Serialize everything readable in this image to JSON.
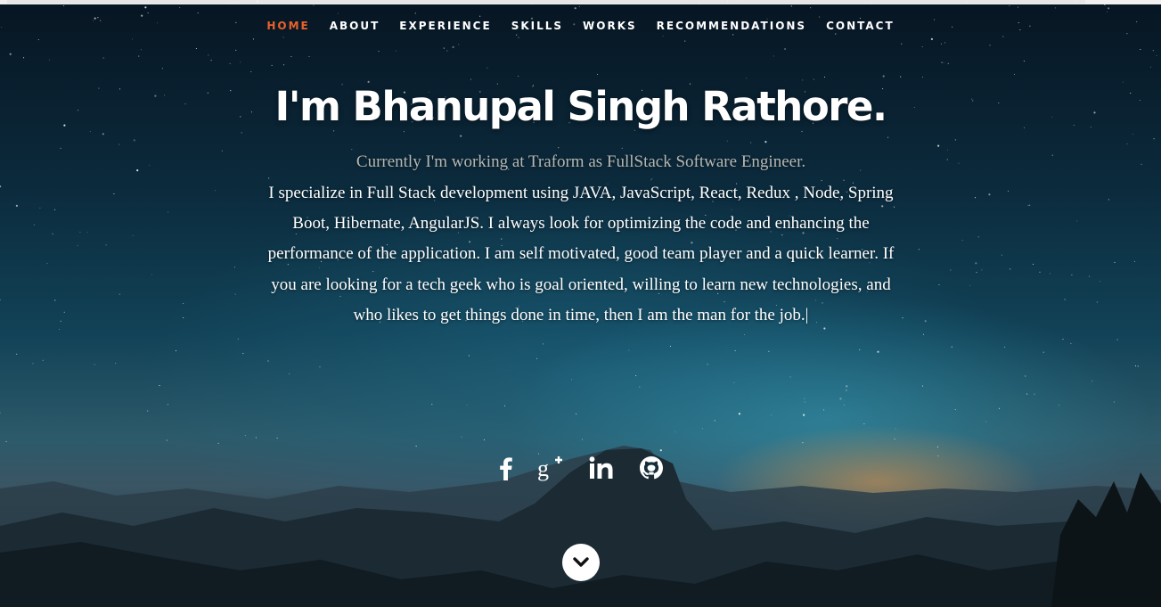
{
  "nav": {
    "items": [
      {
        "label": "HOME",
        "active": true
      },
      {
        "label": "ABOUT",
        "active": false
      },
      {
        "label": "EXPERIENCE",
        "active": false
      },
      {
        "label": "SKILLS",
        "active": false
      },
      {
        "label": "WORKS",
        "active": false
      },
      {
        "label": "RECOMMENDATIONS",
        "active": false
      },
      {
        "label": "CONTACT",
        "active": false
      }
    ],
    "active_color": "#e8622a"
  },
  "hero": {
    "headline": "I'm Bhanupal Singh Rathore.",
    "current_role": "Currently I'm working at Traform as FullStack Software Engineer.",
    "bio": "I specialize in Full Stack development using JAVA, JavaScript, React, Redux , Node, Spring Boot, Hibernate, AngularJS. I always look for optimizing the code and enhancing the performance of the application. I am self motivated, good team player and a quick learner. If you are looking for a tech geek who is goal oriented, willing to learn new technologies, and who likes to get things done in time, then I am the man for the job.",
    "cursor": "|"
  },
  "social": [
    {
      "name": "facebook-icon"
    },
    {
      "name": "google-plus-icon"
    },
    {
      "name": "linkedin-icon"
    },
    {
      "name": "github-icon"
    }
  ],
  "scroll_down": {
    "icon": "chevron-down-icon"
  }
}
